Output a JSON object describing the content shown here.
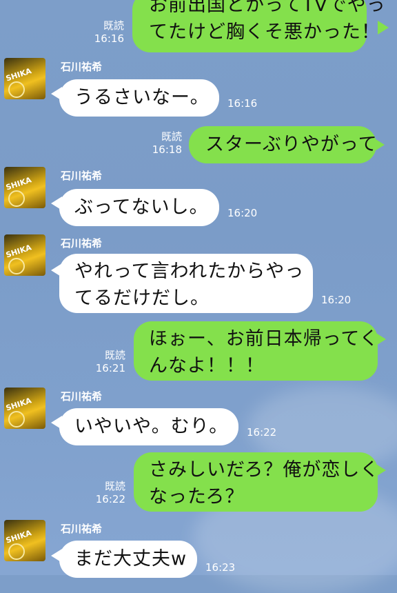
{
  "contact": {
    "name": "石川祐希"
  },
  "read_label": "既読",
  "avatar_logo": "SHIKA",
  "messages": [
    {
      "dir": "out",
      "lines": [
        "お前出国とかってTVでやっ",
        "てたけど胸くそ悪かった！"
      ],
      "read": "既読",
      "time": "16:16"
    },
    {
      "dir": "in",
      "lines": [
        "うるさいなー。"
      ],
      "time": "16:16"
    },
    {
      "dir": "out",
      "lines": [
        "スターぶりやがって"
      ],
      "read": "既読",
      "time": "16:18"
    },
    {
      "dir": "in",
      "lines": [
        "ぶってないし。"
      ],
      "time": "16:20"
    },
    {
      "dir": "in",
      "lines": [
        "やれって言われたからやっ",
        "てるだけだし。"
      ],
      "time": "16:20"
    },
    {
      "dir": "out",
      "lines": [
        "ほぉー、お前日本帰ってく",
        "んなよ！！！"
      ],
      "read": "既読",
      "time": "16:21"
    },
    {
      "dir": "in",
      "lines": [
        "いやいや。むり。"
      ],
      "time": "16:22"
    },
    {
      "dir": "out",
      "lines": [
        "さみしいだろ？俺が恋しく",
        "なったろ？"
      ],
      "read": "既読",
      "time": "16:22"
    },
    {
      "dir": "in",
      "lines": [
        "まだ大丈夫w"
      ],
      "time": "16:23"
    }
  ]
}
